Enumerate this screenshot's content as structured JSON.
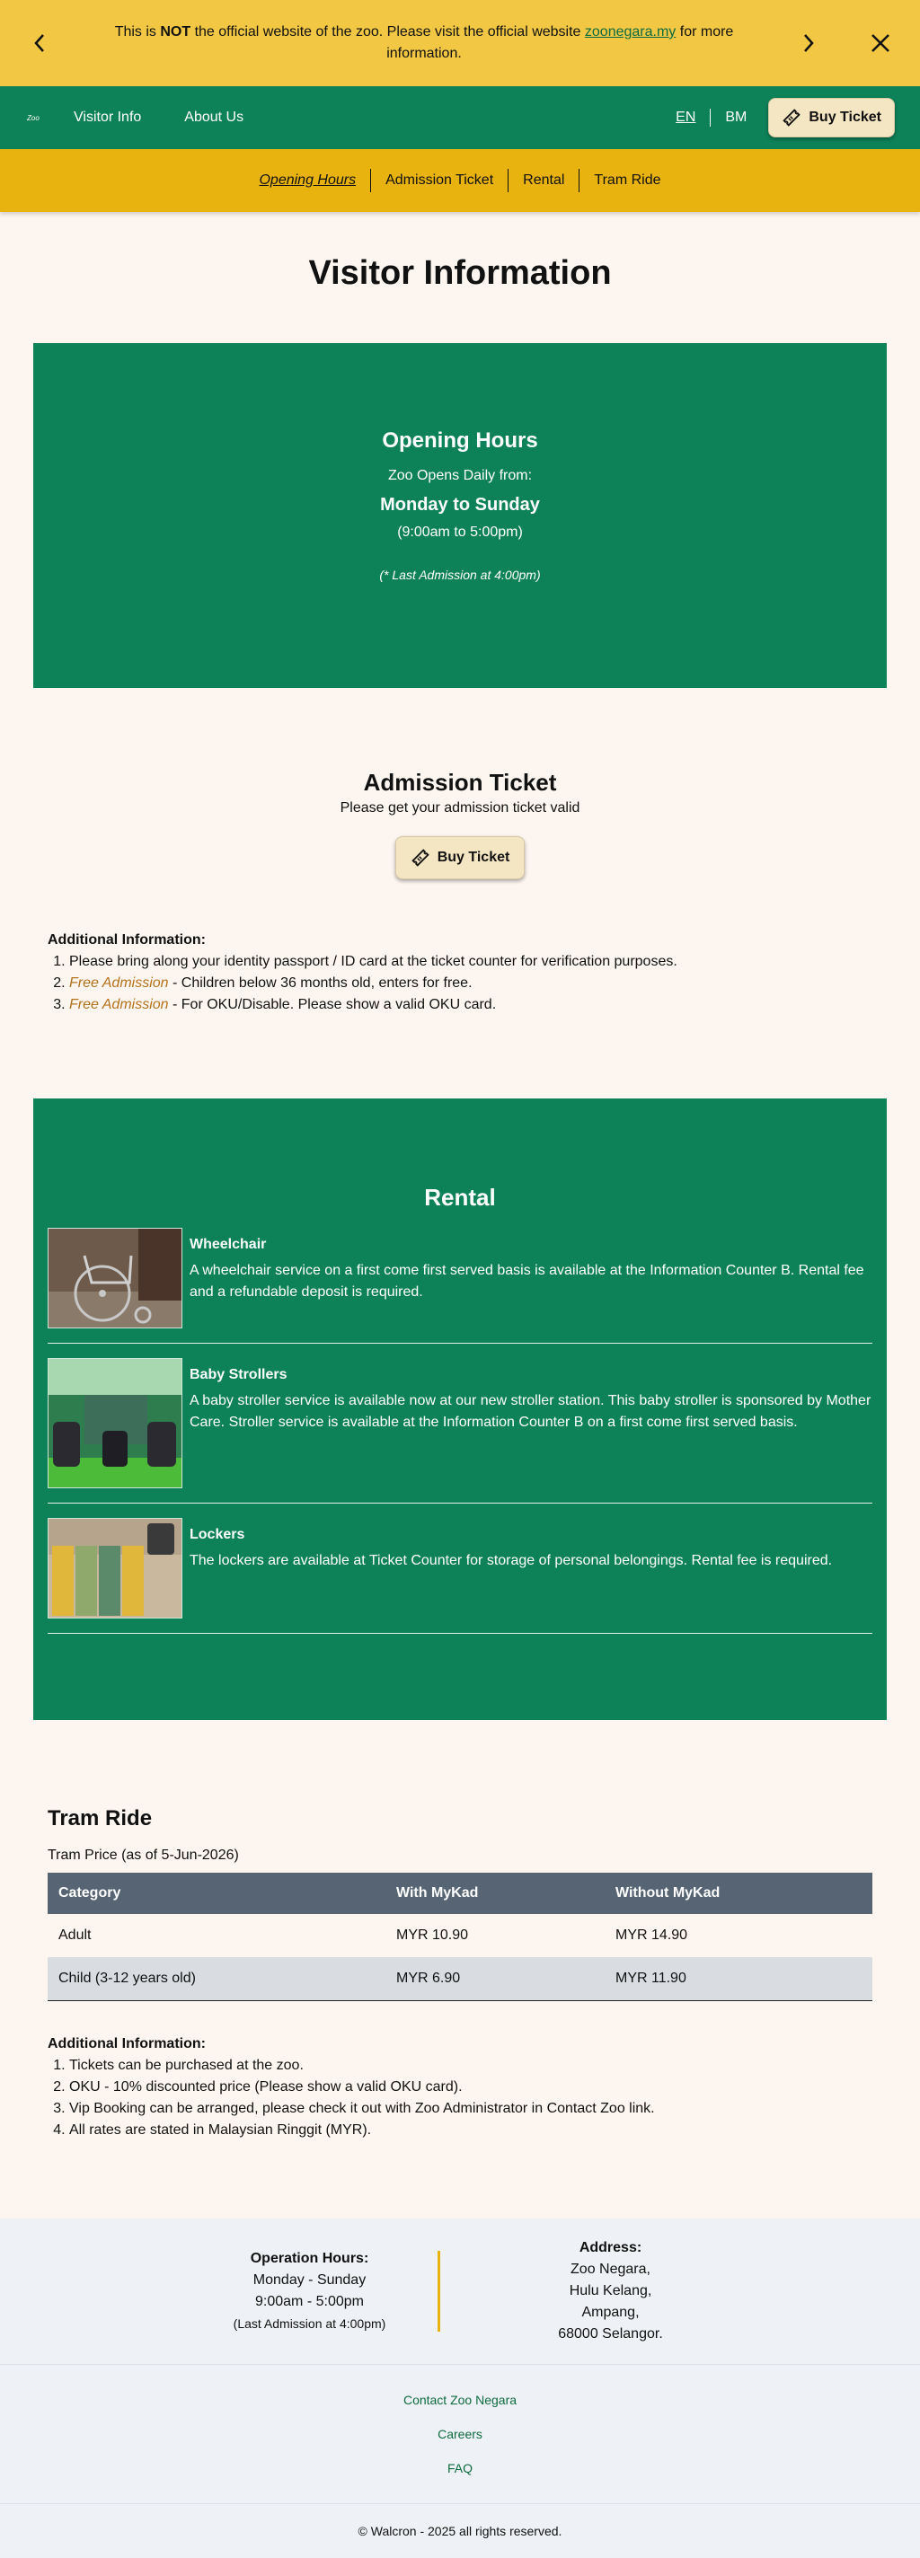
{
  "notice": {
    "text_before": "This is ",
    "text_bold": "NOT",
    "text_middle": " the official website of the zoo. Please visit the official website ",
    "link_text": "zoonegara.my",
    "text_after": " for more information."
  },
  "nav": {
    "logo_text": "Zoo",
    "links": [
      "Visitor Info",
      "About Us"
    ],
    "lang_en": "EN",
    "lang_bm": "BM",
    "buy_ticket": "Buy Ticket"
  },
  "subnav": {
    "items": [
      "Opening Hours",
      "Admission Ticket",
      "Rental",
      "Tram Ride"
    ]
  },
  "page_title": "Visitor Information",
  "opening_hours": {
    "title": "Opening Hours",
    "opens": "Zoo Opens Daily from:",
    "days": "Monday to Sunday",
    "time": "(9:00am to 5:00pm)",
    "last_admission": "(* Last Admission at 4:00pm)"
  },
  "admission": {
    "title": "Admission Ticket",
    "subtitle": "Please get your admission ticket valid",
    "button": "Buy Ticket",
    "info_heading": "Additional Information:",
    "items": [
      {
        "prefix": "",
        "text": "Please bring along your identity passport / ID card at the ticket counter for verification purposes."
      },
      {
        "prefix": "Free Admission",
        "text": " - Children below 36 months old, enters for free."
      },
      {
        "prefix": "Free Admission",
        "text": " - For OKU/Disable. Please show a valid OKU card."
      }
    ]
  },
  "rental": {
    "title": "Rental",
    "items": [
      {
        "name": "Wheelchair",
        "desc": "A wheelchair service on a first come first served basis is available at the Information Counter B. Rental fee and a refundable deposit is required."
      },
      {
        "name": "Baby Strollers",
        "desc": "A baby stroller service is available now at our new stroller station. This baby stroller is sponsored by Mother Care. Stroller service is available at the Information Counter B on a first come first served basis."
      },
      {
        "name": "Lockers",
        "desc": "The lockers are available at Ticket Counter for storage of personal belongings. Rental fee is required."
      }
    ]
  },
  "tram": {
    "title": "Tram Ride",
    "price_note": "Tram Price (as of 5-Jun-2026)",
    "columns": [
      "Category",
      "With MyKad",
      "Without MyKad"
    ],
    "rows": [
      [
        "Adult",
        "MYR 10.90",
        "MYR 14.90"
      ],
      [
        "Child (3-12 years old)",
        "MYR 6.90",
        "MYR 11.90"
      ]
    ],
    "info_heading": "Additional Information:",
    "info_items": [
      "Tickets can be purchased at the zoo.",
      "OKU - 10% discounted price (Please show a valid OKU card).",
      "Vip Booking can be arranged, please check it out with Zoo Administrator in Contact Zoo link.",
      "All rates are stated in Malaysian Ringgit (MYR)."
    ]
  },
  "footer": {
    "hours_title": "Operation Hours:",
    "hours_days": "Monday - Sunday",
    "hours_time": "9:00am - 5:00pm",
    "hours_last": "(Last Admission at 4:00pm)",
    "address_title": "Address:",
    "address_lines": [
      "Zoo Negara,",
      "Hulu Kelang,",
      "Ampang,",
      "68000 Selangor."
    ],
    "links": [
      "Contact Zoo Negara",
      "Careers",
      "FAQ"
    ],
    "copyright": "© Walcron - 2025 all rights reserved."
  },
  "colors": {
    "notice_bg": "#f2c744",
    "green": "#0d8259",
    "subnav_bg": "#e8b20f",
    "page_bg": "#fdf6f0",
    "table_header": "#566474",
    "free_text": "#b5721c"
  },
  "icons": [
    "chevron-left-icon",
    "chevron-right-icon",
    "close-icon",
    "ticket-icon"
  ]
}
